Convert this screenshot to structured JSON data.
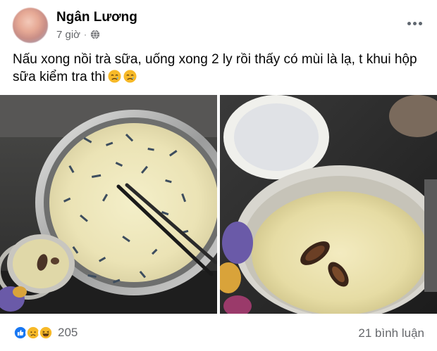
{
  "post": {
    "author": "Ngân Lương",
    "time": "7 giờ",
    "separator": "·",
    "privacy_icon": "globe-icon",
    "more_icon": "more-options-icon",
    "caption": "Nấu xong nồi trà sữa, uống xong 2 ly rồi thấy có mùi là lạ, t khui hộp sữa kiểm tra thì",
    "caption_emojis": [
      "sad-tear-emoji",
      "sad-tear-emoji"
    ],
    "photos": [
      {
        "name": "photo-pot-milk-tea",
        "description_icon": "pot-photo"
      },
      {
        "name": "photo-open-milk-can",
        "description_icon": "can-photo"
      }
    ],
    "reactions": {
      "icons": [
        "like-icon",
        "sad-icon",
        "haha-icon"
      ],
      "count": "205"
    },
    "comments": "21 bình luận"
  },
  "colors": {
    "secondary_text": "#65676b",
    "like_blue": "#1877f2",
    "emoji_yellow": "#f7b928"
  }
}
